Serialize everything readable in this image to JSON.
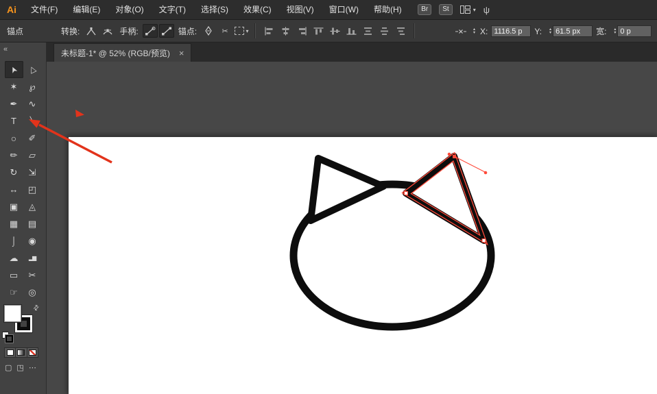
{
  "colors": {
    "ink": "#0d0d0d",
    "paper": "#ffffff",
    "selection": "#ff4a3a",
    "annotation": "#e2331b",
    "logo_orange": "#f7941d"
  },
  "menu_bar": {
    "logo": "Ai",
    "items": [
      "文件(F)",
      "编辑(E)",
      "对象(O)",
      "文字(T)",
      "选择(S)",
      "效果(C)",
      "视图(V)",
      "窗口(W)",
      "帮助(H)"
    ],
    "bridge_label": "Br",
    "stock_label": "St",
    "plug_glyph": "ψ"
  },
  "control_bar": {
    "context_label": "锚点",
    "convert_label": "转换:",
    "handles_label": "手柄:",
    "anchors_label": "锚点:",
    "cut_glyph": "✂",
    "convert_icons": [
      "convert-to-corner",
      "convert-to-smooth"
    ],
    "handle_icons": [
      "show-handles",
      "hide-handles"
    ],
    "anchor_icons": [
      "remove-anchor",
      "cut-path"
    ],
    "align_icons": [
      "align-left",
      "align-center",
      "align-right",
      "align-top",
      "align-middle",
      "align-bottom"
    ],
    "distribute_icons": [
      "distribute-top",
      "distribute-center",
      "distribute-bottom"
    ],
    "x_label": "X:",
    "x_value": "1116.5 p",
    "y_label": "Y:",
    "y_value": "61.5 px",
    "width_label": "宽:",
    "width_value": "0 p"
  },
  "tab_bar": {
    "tab_title": "未标题-1* @ 52% (RGB/预览)",
    "close_glyph": "×"
  },
  "tool_panel": {
    "collapse_glyph": "«",
    "swap_glyph": "⇄",
    "tools": [
      {
        "name": "selection-tool",
        "glyph": "➤"
      },
      {
        "name": "direct-selection-tool",
        "glyph": "▷"
      },
      {
        "name": "magic-wand-tool",
        "glyph": "✶"
      },
      {
        "name": "lasso-tool",
        "glyph": "℘"
      },
      {
        "name": "pen-tool",
        "glyph": "✒"
      },
      {
        "name": "curvature-tool",
        "glyph": "∿"
      },
      {
        "name": "type-tool",
        "glyph": "T"
      },
      {
        "name": "line-segment-tool",
        "glyph": "╲"
      },
      {
        "name": "ellipse-tool",
        "glyph": "○"
      },
      {
        "name": "paintbrush-tool",
        "glyph": "✐"
      },
      {
        "name": "pencil-tool",
        "glyph": "✏"
      },
      {
        "name": "eraser-tool",
        "glyph": "▱"
      },
      {
        "name": "rotate-tool",
        "glyph": "↻"
      },
      {
        "name": "scale-tool",
        "glyph": "⇲"
      },
      {
        "name": "width-tool",
        "glyph": "↔"
      },
      {
        "name": "free-transform-tool",
        "glyph": "◰"
      },
      {
        "name": "shape-builder-tool",
        "glyph": "▣"
      },
      {
        "name": "perspective-grid-tool",
        "glyph": "◬"
      },
      {
        "name": "mesh-tool",
        "glyph": "▦"
      },
      {
        "name": "gradient-tool",
        "glyph": "▤"
      },
      {
        "name": "eyedropper-tool",
        "glyph": "⌡"
      },
      {
        "name": "blend-tool",
        "glyph": "◉"
      },
      {
        "name": "symbol-sprayer-tool",
        "glyph": "☁"
      },
      {
        "name": "graph-tool",
        "glyph": "▂▆"
      },
      {
        "name": "artboard-tool",
        "glyph": "▭"
      },
      {
        "name": "slice-tool",
        "glyph": "✂"
      },
      {
        "name": "hand-tool",
        "glyph": "☞"
      },
      {
        "name": "zoom-tool",
        "glyph": "◎"
      }
    ],
    "bottom_icons": [
      {
        "name": "draw-normal-mode-icon",
        "glyph": "▢"
      },
      {
        "name": "draw-inside-mode-icon",
        "glyph": "◳"
      },
      {
        "name": "screen-mode-icon",
        "glyph": "⋯"
      }
    ]
  },
  "ui": {
    "caret_down": "▾",
    "stepper_up": "▴",
    "stepper_down": "▾"
  }
}
